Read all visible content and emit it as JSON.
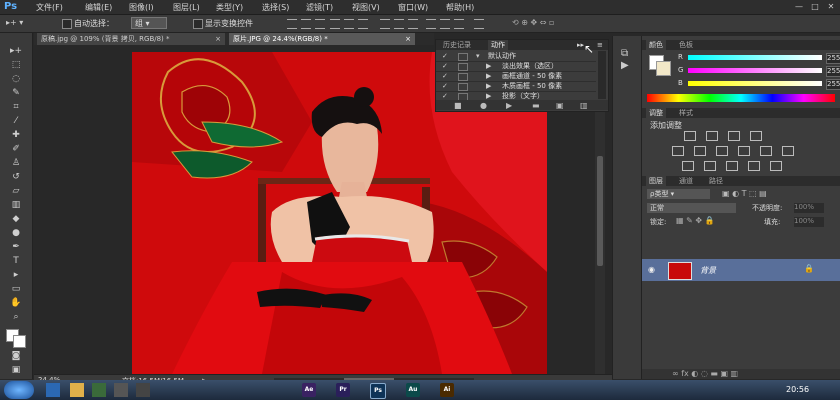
{
  "app": {
    "logo": "Ps"
  },
  "menu": [
    "文件(F)",
    "编辑(E)",
    "图像(I)",
    "图层(L)",
    "类型(Y)",
    "选择(S)",
    "滤镜(T)",
    "视图(V)",
    "窗口(W)",
    "帮助(H)"
  ],
  "window_controls": [
    "—",
    "□",
    "✕"
  ],
  "options": {
    "auto_select_label": "自动选择：",
    "auto_select_value": "组",
    "show_transform_label": "显示变换控件"
  },
  "tabs": [
    {
      "label": "原稿.jpg @ 109% (背景 拷贝, RGB/8) *",
      "close": "×"
    },
    {
      "label": "原片.JPG @ 24.4%(RGB/8) *",
      "close": "×"
    }
  ],
  "status": {
    "zoom": "24.4%",
    "doc": "文档:16.5M/16.5M"
  },
  "actions_panel": {
    "tabs": [
      "历史记录",
      "动作"
    ],
    "rows": [
      {
        "check": "✓",
        "expand": "▾",
        "label": "默认动作"
      },
      {
        "check": "✓",
        "expand": "▶",
        "label": "淡出效果（选区）"
      },
      {
        "check": "✓",
        "expand": "▶",
        "label": "画框通道 - 50 像素"
      },
      {
        "check": "✓",
        "expand": "▶",
        "label": "木质画框 - 50 像素"
      },
      {
        "check": "✓",
        "expand": "▶",
        "label": "投影（文字）"
      }
    ]
  },
  "color_panel": {
    "tabs": [
      "颜色",
      "色板"
    ],
    "channels": [
      {
        "name": "R",
        "value": "255"
      },
      {
        "name": "G",
        "value": "255"
      },
      {
        "name": "B",
        "value": "255"
      }
    ]
  },
  "adjustments_panel": {
    "tabs": [
      "调整",
      "样式"
    ],
    "title": "添加调整"
  },
  "layers_panel": {
    "tabs": [
      "图层",
      "通道",
      "路径"
    ],
    "filter": "ρ类型",
    "blend_mode": "正常",
    "opacity_label": "不透明度:",
    "opacity_value": "100%",
    "lock_label": "锁定:",
    "fill_label": "填充:",
    "fill_value": "100%",
    "layer_name": "背景"
  },
  "taskbar": {
    "clock": "20:56",
    "apps": [
      "Ae",
      "Pr",
      "Ps",
      "Au",
      "Ai"
    ]
  },
  "colors": {
    "accent_ps": "#5fb2ff",
    "photo_red": "#d20b0b",
    "selected_layer": "#596f9a"
  }
}
